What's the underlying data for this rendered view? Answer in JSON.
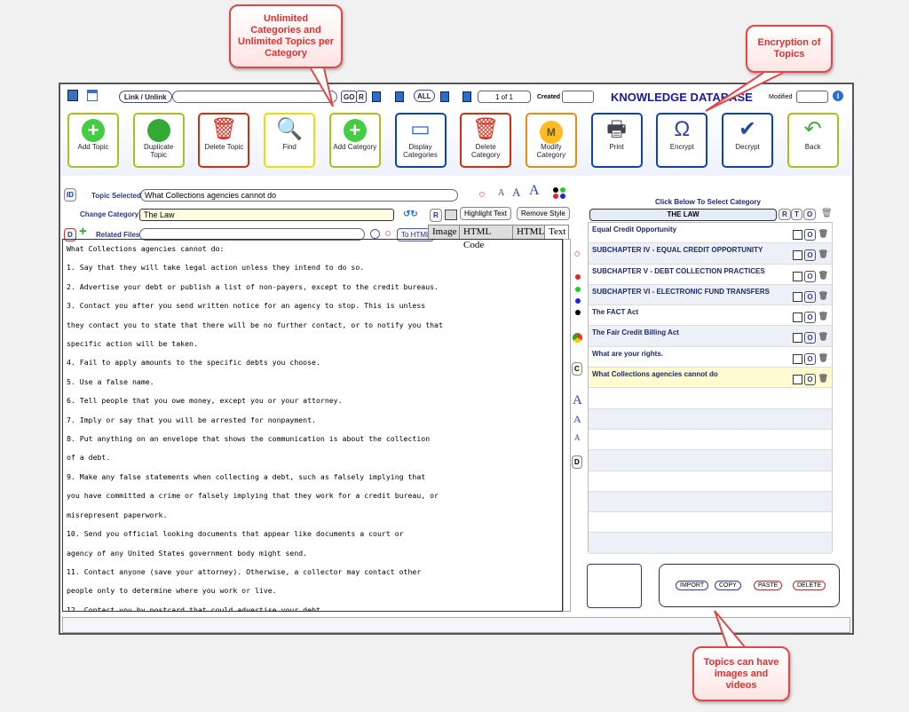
{
  "callouts": {
    "categories": "Unlimited Categories and Unlimited Topics per Category",
    "encryption": "Encryption of Topics",
    "media": "Topics can have images and videos"
  },
  "topbar": {
    "link": "Link / Unlink",
    "go": "GO",
    "r": "R",
    "all": "ALL",
    "page": "1 of 1",
    "created": "Created",
    "title": "KNOWLEDGE DATABASE",
    "modified": "Modified"
  },
  "toolbar": [
    {
      "label": "Add Topic",
      "icon": "plus-circle-icon",
      "color": "#a8c020"
    },
    {
      "label": "Duplicate Topic",
      "icon": "globe-icon",
      "color": "#a8c020"
    },
    {
      "label": "Delete Topic",
      "icon": "trash-icon",
      "color": "#d03010"
    },
    {
      "label": "Find",
      "icon": "magnifier-icon",
      "color": "#e8e000"
    },
    {
      "label": "Add Category",
      "icon": "plus-circle-icon",
      "color": "#a8c020"
    },
    {
      "label": "Display Categories",
      "icon": "window-icon",
      "color": "#1040c0"
    },
    {
      "label": "Delete Category",
      "icon": "trash-icon",
      "color": "#d03010"
    },
    {
      "label": "Modify Category",
      "icon": "m-badge-icon",
      "color": "#e09010"
    },
    {
      "label": "Print",
      "icon": "printer-icon",
      "color": "#1040c0"
    },
    {
      "label": "Encrypt",
      "icon": "omega-icon",
      "color": "#1040c0"
    },
    {
      "label": "Decrypt",
      "icon": "abc-check-icon",
      "color": "#1040c0"
    },
    {
      "label": "Back",
      "icon": "back-arrow-icon",
      "color": "#a8c020"
    }
  ],
  "editor": {
    "id": "ID",
    "topic_label": "Topic Selected:",
    "topic": "What Collections agencies cannot do",
    "category_label": "Change Category:",
    "category": "The Law",
    "r": "R",
    "highlight": "Highlight Text",
    "remove_style": "Remove Style",
    "d": "D",
    "related_label": "Related Files:",
    "to_html": "To HTML",
    "tabs": [
      "Image",
      "HTML Code",
      "HTML",
      "Text"
    ],
    "active_tab": "Text",
    "lines": [
      "What Collections agencies cannot do:",
      "1. Say that they will take legal action unless they intend to do so.",
      "2. Advertise your debt or publish a list of non-payers, except to the credit bureaus.",
      "3. Contact you after you send written notice for an agency to stop. This is unless",
      "they contact you to state that there will be no further contact, or to notify you that",
      "specific action will be taken.",
      "4. Fail to apply amounts to the specific debts you choose.",
      "5. Use a false name.",
      "6. Tell people that you owe money, except you or your attorney.",
      "7. Imply or say that you will be arrested for nonpayment.",
      "8. Put anything on an envelope that shows the communication is about the collection",
      "of a debt.",
      "9. Make any false statements when collecting a debt, such as falsely implying that",
      "you have committed a crime or falsely implying that they work for a credit bureau, or",
      "misrepresent paperwork.",
      "10. Send you official looking documents that appear like documents a court or",
      "agency of any United States government body might send.",
      "11. Contact anyone (save your attorney). Otherwise, a collector may contact other",
      "people only to determine where you work or live.",
      "12. Contact you by postcard that could advertise your debt."
    ]
  },
  "side": {
    "c": "C",
    "d": "D",
    "a": "A"
  },
  "categories": {
    "heading": "Click Below To Select Category",
    "current": "THE LAW",
    "btns": [
      "R",
      "T",
      "O"
    ],
    "o": "O",
    "items": [
      "Equal Credit Opportunity",
      "SUBCHAPTER IV - EQUAL CREDIT OPPORTUNITY",
      "SUBCHAPTER V - DEBT COLLECTION PRACTICES",
      "SUBCHAPTER VI - ELECTRONIC FUND TRANSFERS",
      "The FACT Act",
      "The Fair Credit Billing Act",
      "What are your rights.",
      "What Collections agencies cannot do"
    ],
    "selected": 7
  },
  "media_buttons": [
    "IMPORT",
    "COPY",
    "PASTE",
    "DELETE"
  ]
}
